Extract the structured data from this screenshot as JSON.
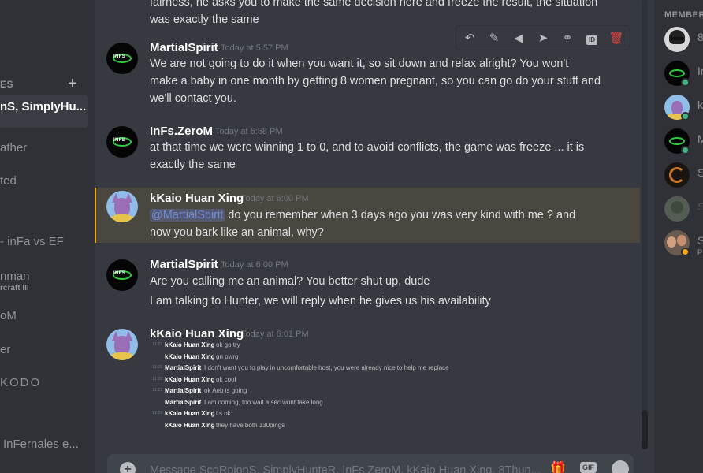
{
  "sidebar": {
    "header": "ES",
    "items": [
      {
        "name": "nS, SimplyHu...",
        "sub": "",
        "active": true
      },
      {
        "name": "ather",
        "sub": ""
      },
      {
        "name": "ted",
        "sub": ""
      },
      {
        "name": "- inFa vs EF",
        "sub": ""
      },
      {
        "name": "nman",
        "sub": "rcraft III"
      },
      {
        "name": "oM",
        "sub": ""
      },
      {
        "name": "er",
        "sub": ""
      },
      {
        "name": "KODO",
        "sub": ""
      },
      {
        "name": "InFernales e...",
        "sub": ""
      }
    ]
  },
  "chat": {
    "top_cut_lines": [
      "fairness, he asks you to make the same decision here and freeze the result, the situation",
      "was exactly the same"
    ],
    "messages": [
      {
        "author": "MartialSpirit",
        "timestamp": "Today at 5:57 PM",
        "lines": [
          "We are not going to do it when you want it, so sit down and relax alright? You won't",
          "make a baby in one month by getting 8 women pregnant, so you can go do your stuff and",
          "we'll contact you."
        ]
      },
      {
        "author": "InFs.ZeroM",
        "timestamp": "Today at 5:58 PM",
        "lines": [
          "at that time we were winning 1 to 0, and to avoid conflicts, the game was freeze ... it is",
          "exactly the same"
        ]
      },
      {
        "author": "kKaio Huan Xing",
        "timestamp": "Today at 6:00 PM",
        "mention": "@MartialSpirit",
        "line1_rest": " do you remember when 3 days ago you was very kind with me ? and",
        "line2": "now you bark like an animal, why?"
      },
      {
        "author": "MartialSpirit",
        "timestamp": "Today at 6:00 PM",
        "lines": [
          "Are you calling me an animal? You better shut up, dude",
          "I am talking to Hunter, we will reply when he gives us his availability"
        ]
      },
      {
        "author": "kKaio Huan Xing",
        "timestamp": "Today at 6:01 PM"
      }
    ],
    "log": [
      {
        "time": "11:21",
        "name": "kKaio Huan Xing",
        "text": "ok go try"
      },
      {
        "time": "",
        "name": "kKaio Huan Xing",
        "text": "gn pwrg"
      },
      {
        "time": "11:21",
        "name": "MartialSpirit",
        "text": "I don't want you to play in uncomfortable host, you were already nice to help me replace"
      },
      {
        "time": "11:22",
        "name": "kKaio Huan Xing",
        "text": "ok cool"
      },
      {
        "time": "11:22",
        "name": "MartialSpirit",
        "text": "ok Aeb is going"
      },
      {
        "time": "",
        "name": "MartialSpirit",
        "text": "I am coming, too wait a sec wont take long"
      },
      {
        "time": "11:23",
        "name": "kKaio Huan Xing",
        "text": "its ok"
      },
      {
        "time": "",
        "name": "kKaio Huan Xing",
        "text": "they have both 130pings"
      }
    ],
    "input_placeholder": "Message ScoRpionS, SimplyHunteR, InFs.ZeroM, kKaio Huan Xing, 8Thun..."
  },
  "toolbar": {
    "icons": [
      "reply-icon",
      "pencil-icon",
      "tag-icon",
      "pin-icon",
      "link-icon",
      "id-icon",
      "trash-icon"
    ],
    "id_label": "ID"
  },
  "input": {
    "gif_label": "GIF"
  },
  "members": {
    "header": "MEMBER",
    "list": [
      {
        "name": "8",
        "sub": "",
        "status": ""
      },
      {
        "name": "In",
        "sub": "",
        "status": "#43b581"
      },
      {
        "name": "k",
        "sub": "",
        "status": "#43b581"
      },
      {
        "name": "M",
        "sub": "",
        "status": "#43b581"
      },
      {
        "name": "S",
        "sub": "",
        "status": ""
      },
      {
        "name": "S",
        "sub": "",
        "status": "",
        "dim": true
      },
      {
        "name": "S",
        "sub": "P",
        "status": "#faa61a"
      }
    ]
  },
  "colors": {
    "background": "#36393f",
    "sidebar": "#2f3136",
    "mention_highlight": "#4a4741",
    "mention_bar": "#faa61a",
    "online": "#43b581",
    "danger": "#f04747"
  }
}
